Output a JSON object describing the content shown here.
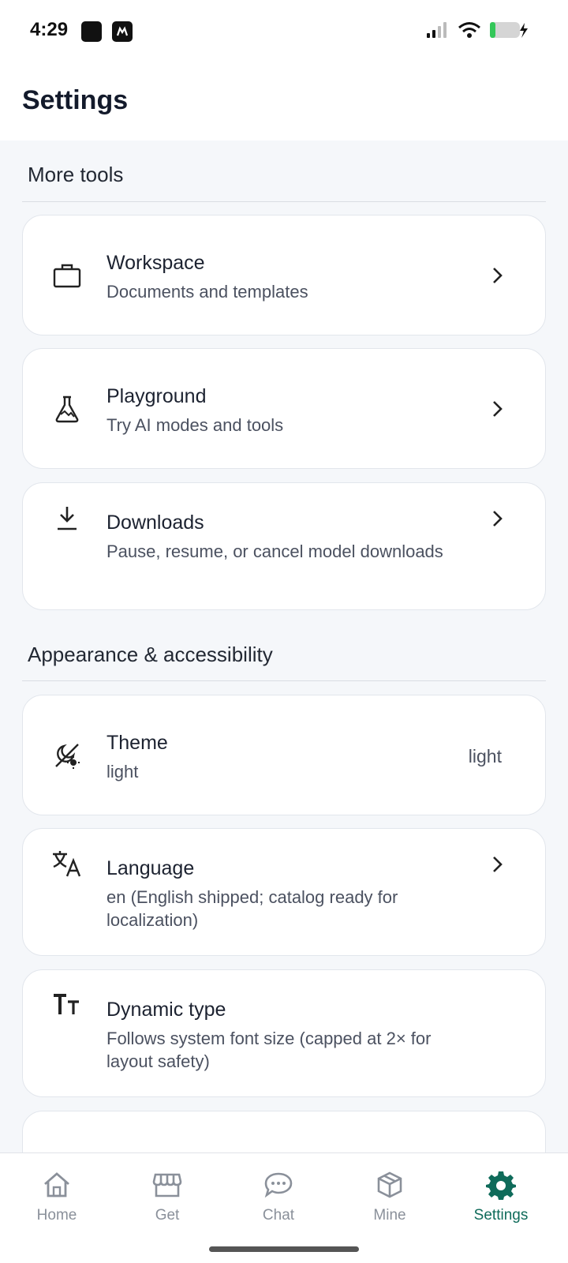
{
  "status": {
    "time": "4:29",
    "icons": [
      "app-icon",
      "app-icon",
      "cellular-signal-icon",
      "wifi-icon",
      "battery-charging-icon"
    ]
  },
  "header": {
    "title": "Settings"
  },
  "sections": [
    {
      "title": "More tools",
      "items": [
        {
          "icon": "briefcase-icon",
          "title": "Workspace",
          "subtitle": "Documents and templates",
          "chevron": true
        },
        {
          "icon": "flask-icon",
          "title": "Playground",
          "subtitle": "Try AI modes and tools",
          "chevron": true
        },
        {
          "icon": "download-icon",
          "title": "Downloads",
          "subtitle": "Pause, resume, or cancel model downloads",
          "chevron": true
        }
      ]
    },
    {
      "title": "Appearance & accessibility",
      "items": [
        {
          "icon": "theme-icon",
          "title": "Theme",
          "subtitle": "light",
          "value": "light"
        },
        {
          "icon": "translate-icon",
          "title": "Language",
          "subtitle": "en (English shipped; catalog ready for localization)",
          "chevron": true
        },
        {
          "icon": "text-size-icon",
          "title": "Dynamic type",
          "subtitle": "Follows system font size (capped at 2× for layout safety)"
        }
      ]
    }
  ],
  "tabs": [
    {
      "label": "Home",
      "icon": "home-icon",
      "active": false
    },
    {
      "label": "Get",
      "icon": "store-icon",
      "active": false
    },
    {
      "label": "Chat",
      "icon": "chat-bubble-icon",
      "active": false
    },
    {
      "label": "Mine",
      "icon": "cube-icon",
      "active": false
    },
    {
      "label": "Settings",
      "icon": "gear-icon",
      "active": true
    }
  ],
  "colors": {
    "accent": "#0f6b5a",
    "inactive": "#8a909a",
    "background": "#f5f7fa"
  }
}
